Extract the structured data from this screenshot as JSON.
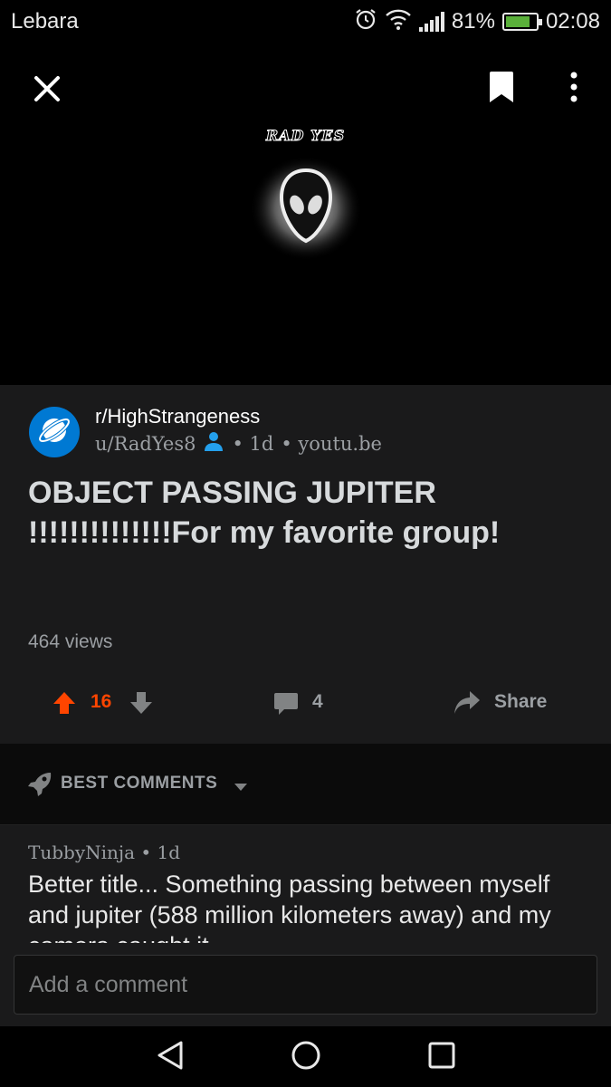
{
  "status_bar": {
    "carrier": "Lebara",
    "battery_percent": "81%",
    "battery_level": 0.81,
    "time": "02:08",
    "icons": [
      "alarm-icon",
      "wifi-icon",
      "signal-icon",
      "battery-icon"
    ]
  },
  "media": {
    "brand_text": "RAD YES",
    "icons": [
      "close-icon",
      "bookmark-icon",
      "more-vertical-icon"
    ]
  },
  "post": {
    "subreddit": "r/HighStrangeness",
    "author": "u/RadYes8",
    "age": "• 1d",
    "domain": "• youtu.be",
    "title": "OBJECT PASSING JUPITER !!!!!!!!!!!!!!For my favorite group!",
    "views": "464 views",
    "score": "16",
    "comment_count": "4",
    "share_label": "Share",
    "colors": {
      "upvote_active": "#ff4500",
      "subreddit_icon": "#0079d3"
    }
  },
  "sort": {
    "label": "BEST COMMENTS"
  },
  "comments": [
    {
      "author": "TubbyNinja",
      "age": "• 1d",
      "body": "Better title... Something passing between myself and jupiter (588 million kilometers away) and my camera caught it"
    }
  ],
  "composer": {
    "placeholder": "Add a comment"
  },
  "navbar": {
    "icons": [
      "back-icon",
      "home-icon",
      "recents-icon"
    ]
  }
}
